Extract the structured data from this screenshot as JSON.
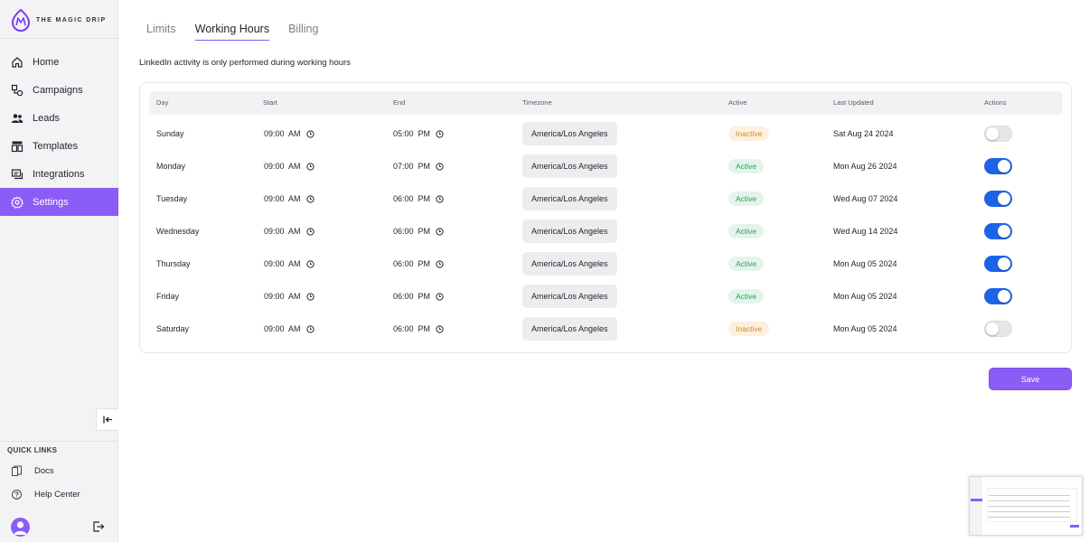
{
  "brand": {
    "name": "THE MAGIC DRIP",
    "accent": "#8b5cf6"
  },
  "nav": [
    {
      "label": "Home",
      "icon": "home-icon"
    },
    {
      "label": "Campaigns",
      "icon": "campaigns-icon"
    },
    {
      "label": "Leads",
      "icon": "users-icon"
    },
    {
      "label": "Templates",
      "icon": "templates-icon"
    },
    {
      "label": "Integrations",
      "icon": "integrations-icon"
    },
    {
      "label": "Settings",
      "icon": "gear-icon",
      "active": true
    }
  ],
  "quick_links": {
    "title": "QUICK LINKS",
    "items": [
      {
        "label": "Docs",
        "icon": "docs-icon"
      },
      {
        "label": "Help Center",
        "icon": "help-icon"
      }
    ]
  },
  "tabs": [
    {
      "label": "Limits"
    },
    {
      "label": "Working Hours",
      "active": true
    },
    {
      "label": "Billing"
    }
  ],
  "subtitle": "LinkedIn activity is only performed during working hours",
  "table": {
    "columns": [
      "Day",
      "Start",
      "End",
      "Timezone",
      "Active",
      "Last Updated",
      "Actions"
    ],
    "rows": [
      {
        "day": "Sunday",
        "start": "09:00  AM",
        "end": "05:00  PM",
        "tz": "America/Los Angeles",
        "status": "Inactive",
        "updated": "Sat Aug 24 2024",
        "enabled": false
      },
      {
        "day": "Monday",
        "start": "09:00  AM",
        "end": "07:00  PM",
        "tz": "America/Los Angeles",
        "status": "Active",
        "updated": "Mon Aug 26 2024",
        "enabled": true
      },
      {
        "day": "Tuesday",
        "start": "09:00  AM",
        "end": "06:00  PM",
        "tz": "America/Los Angeles",
        "status": "Active",
        "updated": "Wed Aug 07 2024",
        "enabled": true
      },
      {
        "day": "Wednesday",
        "start": "09:00  AM",
        "end": "06:00  PM",
        "tz": "America/Los Angeles",
        "status": "Active",
        "updated": "Wed Aug 14 2024",
        "enabled": true
      },
      {
        "day": "Thursday",
        "start": "09:00  AM",
        "end": "06:00  PM",
        "tz": "America/Los Angeles",
        "status": "Active",
        "updated": "Mon Aug 05 2024",
        "enabled": true
      },
      {
        "day": "Friday",
        "start": "09:00  AM",
        "end": "06:00  PM",
        "tz": "America/Los Angeles",
        "status": "Active",
        "updated": "Mon Aug 05 2024",
        "enabled": true
      },
      {
        "day": "Saturday",
        "start": "09:00  AM",
        "end": "06:00  PM",
        "tz": "America/Los Angeles",
        "status": "Inactive",
        "updated": "Mon Aug 05 2024",
        "enabled": false
      }
    ]
  },
  "save_label": "Save",
  "colors": {
    "toggle_on": "#1d63e8",
    "active_badge": "#2f9e58",
    "inactive_badge": "#d38b23"
  }
}
